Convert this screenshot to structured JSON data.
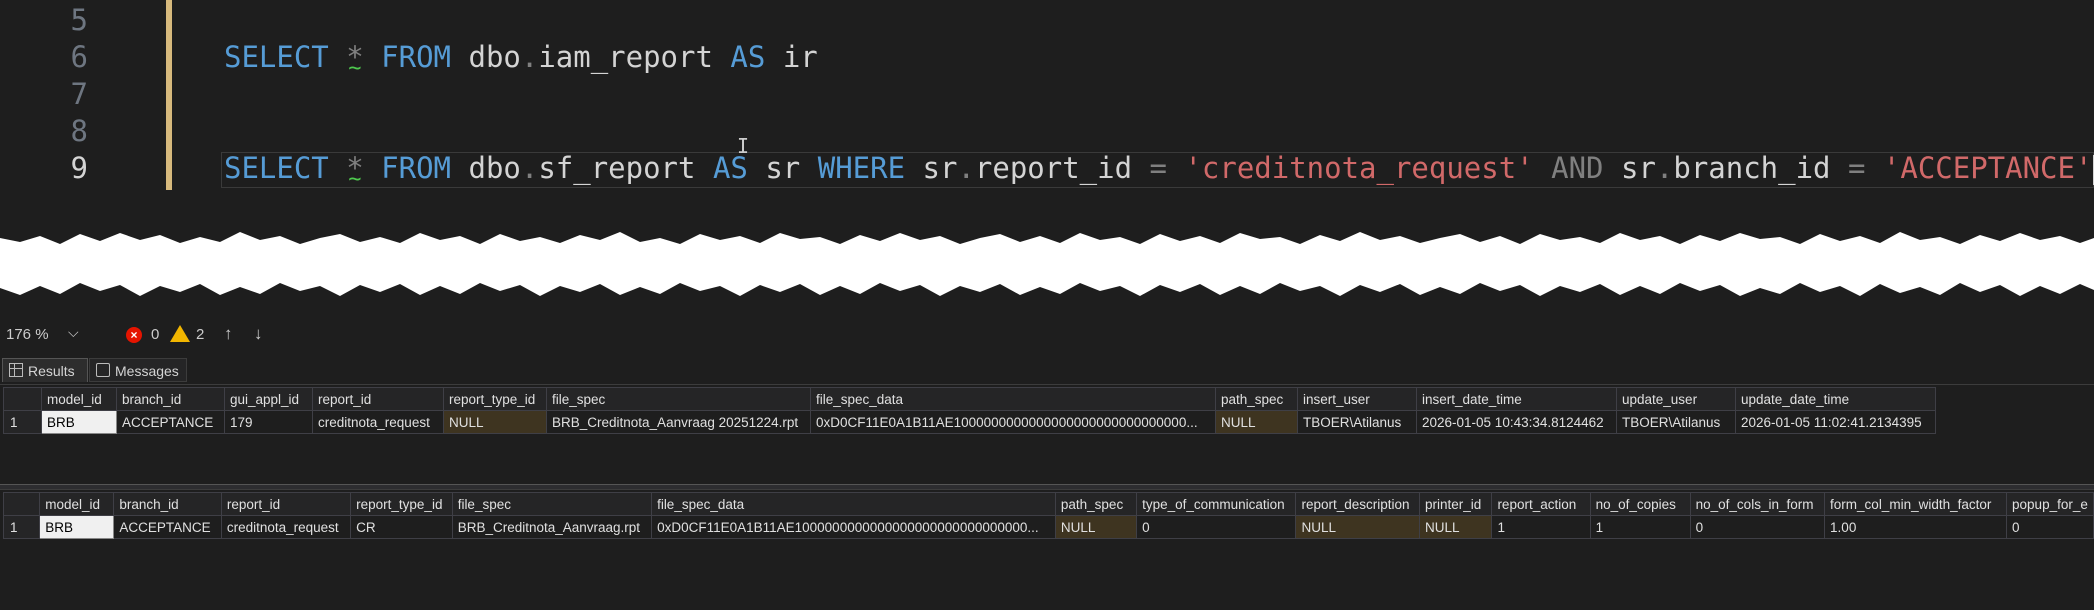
{
  "editor": {
    "line_numbers": [
      "5",
      "6",
      "7",
      "8",
      "9"
    ],
    "line6": {
      "kw_select": "SELECT",
      "star": "*",
      "kw_from": "FROM",
      "schema": "dbo",
      "dot": ".",
      "table": "iam_report",
      "kw_as": "AS",
      "alias": "ir"
    },
    "line9": {
      "kw_select": "SELECT",
      "star": "*",
      "kw_from": "FROM",
      "schema": "dbo",
      "dot": ".",
      "table": "sf_report",
      "kw_as": "AS",
      "alias": "sr",
      "kw_where": "WHERE",
      "col1_alias": "sr",
      "col1": "report_id",
      "eq": "=",
      "val1": "'creditnota_request'",
      "kw_and": "AND",
      "col2_alias": "sr",
      "col2": "branch_id",
      "val2": "'ACCEPTANCE'"
    }
  },
  "statusbar": {
    "zoom": "176 %",
    "zoom_dropdown": "⌵",
    "errors": "0",
    "warnings": "2",
    "error_icon": "error-icon",
    "warning_icon": "warning-icon",
    "up_arrow": "↑",
    "down_arrow": "↓"
  },
  "tabs": {
    "results": "Results",
    "messages": "Messages"
  },
  "grid1": {
    "columns": [
      "model_id",
      "branch_id",
      "gui_appl_id",
      "report_id",
      "report_type_id",
      "file_spec",
      "file_spec_data",
      "path_spec",
      "insert_user",
      "insert_date_time",
      "update_user",
      "update_date_time"
    ],
    "rows": [
      {
        "rownum": "1",
        "cells": [
          "BRB",
          "ACCEPTANCE",
          "179",
          "creditnota_request",
          "NULL",
          "BRB_Creditnota_Aanvraag 20251224.rpt",
          "0xD0CF11E0A1B11AE1000000000000000000000000000000...",
          "NULL",
          "TBOER\\Atilanus",
          "2026-01-05 10:43:34.8124462",
          "TBOER\\Atilanus",
          "2026-01-05 11:02:41.2134395"
        ]
      }
    ]
  },
  "grid2": {
    "columns": [
      "model_id",
      "branch_id",
      "report_id",
      "report_type_id",
      "file_spec",
      "file_spec_data",
      "path_spec",
      "type_of_communication",
      "report_description",
      "printer_id",
      "report_action",
      "no_of_copies",
      "no_of_cols_in_form",
      "form_col_min_width_factor",
      "popup_for_e"
    ],
    "rows": [
      {
        "rownum": "1",
        "cells": [
          "BRB",
          "ACCEPTANCE",
          "creditnota_request",
          "CR",
          "BRB_Creditnota_Aanvraag.rpt",
          "0xD0CF11E0A1B11AE1000000000000000000000000000000...",
          "NULL",
          "0",
          "NULL",
          "NULL",
          "1",
          "1",
          "0",
          "1.00",
          "0"
        ]
      }
    ]
  },
  "colors": {
    "keyword": "#569cd6",
    "string": "#d16969",
    "null_bg": "#3e3420",
    "change_bar": "#d7ba7d"
  }
}
